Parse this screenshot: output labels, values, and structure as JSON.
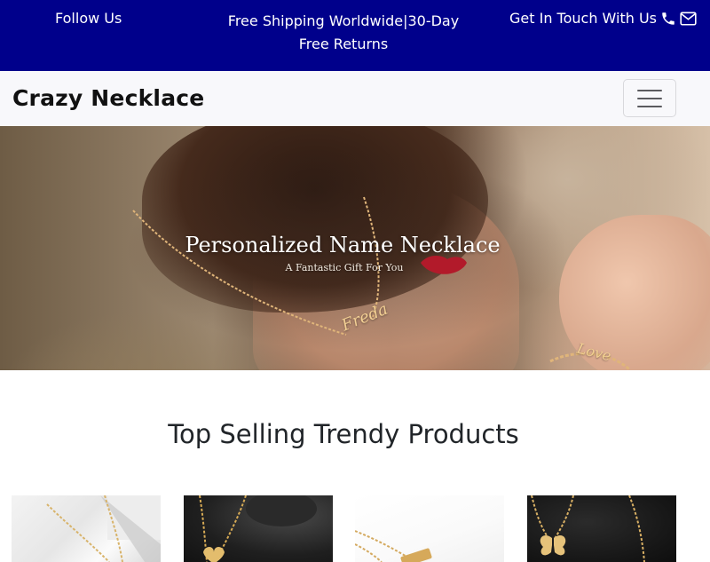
{
  "topbar": {
    "follow_label": "Follow Us",
    "shipping_text": "Free Shipping Worldwide|30-Day Free Returns",
    "contact_label": "Get In Touch With Us",
    "bg_color": "#00008b"
  },
  "navbar": {
    "brand": "Crazy Necklace",
    "toggler_icon": "hamburger-icon"
  },
  "hero": {
    "title": "Personalized Name Necklace",
    "subtitle": "A Fantastic Gift For You",
    "pendant_text": "Freda",
    "bracelet_text": "Love"
  },
  "products_section": {
    "title": "Top Selling Trendy Products"
  },
  "products": [
    {
      "image": "gold-chain-necklace"
    },
    {
      "image": "gold-heart-pendant"
    },
    {
      "image": "gold-bar-necklace"
    },
    {
      "image": "gold-butterfly-necklace"
    }
  ]
}
